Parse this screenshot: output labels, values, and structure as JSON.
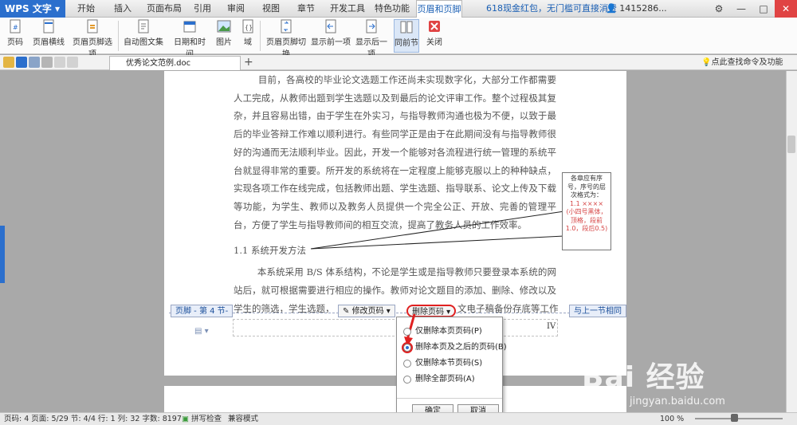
{
  "app": {
    "name": "WPS 文字",
    "promo": "618现金红包，无门槛可直接消费",
    "user": "1415286..."
  },
  "tabs": [
    "开始",
    "插入",
    "页面布局",
    "引用",
    "审阅",
    "视图",
    "章节",
    "开发工具",
    "特色功能",
    "页眉和页脚"
  ],
  "ribbon": {
    "page_number": "页码",
    "header_line": "页眉横线",
    "hf_options": "页眉页脚选项",
    "auto_text": "自动图文集",
    "date_time": "日期和时间",
    "picture": "图片",
    "field": "域",
    "switch": "页眉页脚切换",
    "prev": "显示前一项",
    "next": "显示后一项",
    "same_as_prev": "同前节",
    "close": "关闭"
  },
  "doc": {
    "tab_title": "优秀论文范例.doc",
    "find": "点此查找命令及功能"
  },
  "body": {
    "para1": "        目前，各高校的毕业论文选题工作还尚未实现数字化，大部分工作都需要人工完成，从教师出题到学生选题以及到最后的论文评审工作。整个过程极其复杂，并且容易出错，由于学生在外实习，与指导教师沟通也极为不便，以致于最后的毕业答辩工作难以顺利进行。有些同学正是由于在此期间没有与指导教师很好的沟通而无法顺利毕业。因此，开发一个能够对各流程进行统一管理的系统平台就显得非常的重要。所开发的系统将在一定程度上能够克服以上的种种缺点，实现各项工作在线完成，包括教师出题、学生选题、指导联系、论文上传及下载等功能，为学生、教师以及教务人员提供一个完全公正、开放、完善的管理平台，方便了学生与指导教师间的相互交流，提高了教务人员的工作效率。",
    "heading": "1.1   系统开发方法",
    "para2": "        本系统采用 B/S 体系结构，不论是学生或是指导教师只要登录本系统的网站后，就可根据需要进行相应的操作。教师对论文题目的添加、删除、修改以及对学生的筛选，学生选题，",
    "para2_tail": "文电子稿备份存底等工作"
  },
  "annotation": {
    "line1": "各章应有序号，序号的层次格式为：",
    "line2": "1.1 ×××× (小四号黑体，顶格，段前1.0，段后0.5)"
  },
  "footer": {
    "label": "页脚 - 第 4 节-",
    "edit_page": "修改页码",
    "delete_page": "删除页码",
    "same_prev": "与上一节相同",
    "page_no": "IV"
  },
  "menu": {
    "items": [
      "仅删除本页页码(P)",
      "删除本页及之后的页码(B)",
      "仅删除本节页码(S)",
      "删除全部页码(A)"
    ],
    "selected": 1,
    "ok": "确定",
    "cancel": "取消"
  },
  "status": {
    "text": "页码: 4  页面: 5/29  节: 4/4  行: 1  列: 32  字数: 8197",
    "spell": "拼写检查",
    "compat": "兼容模式",
    "zoom": "100 %"
  },
  "watermark": {
    "brand": "Bai 经验",
    "url": "jingyan.baidu.com"
  }
}
